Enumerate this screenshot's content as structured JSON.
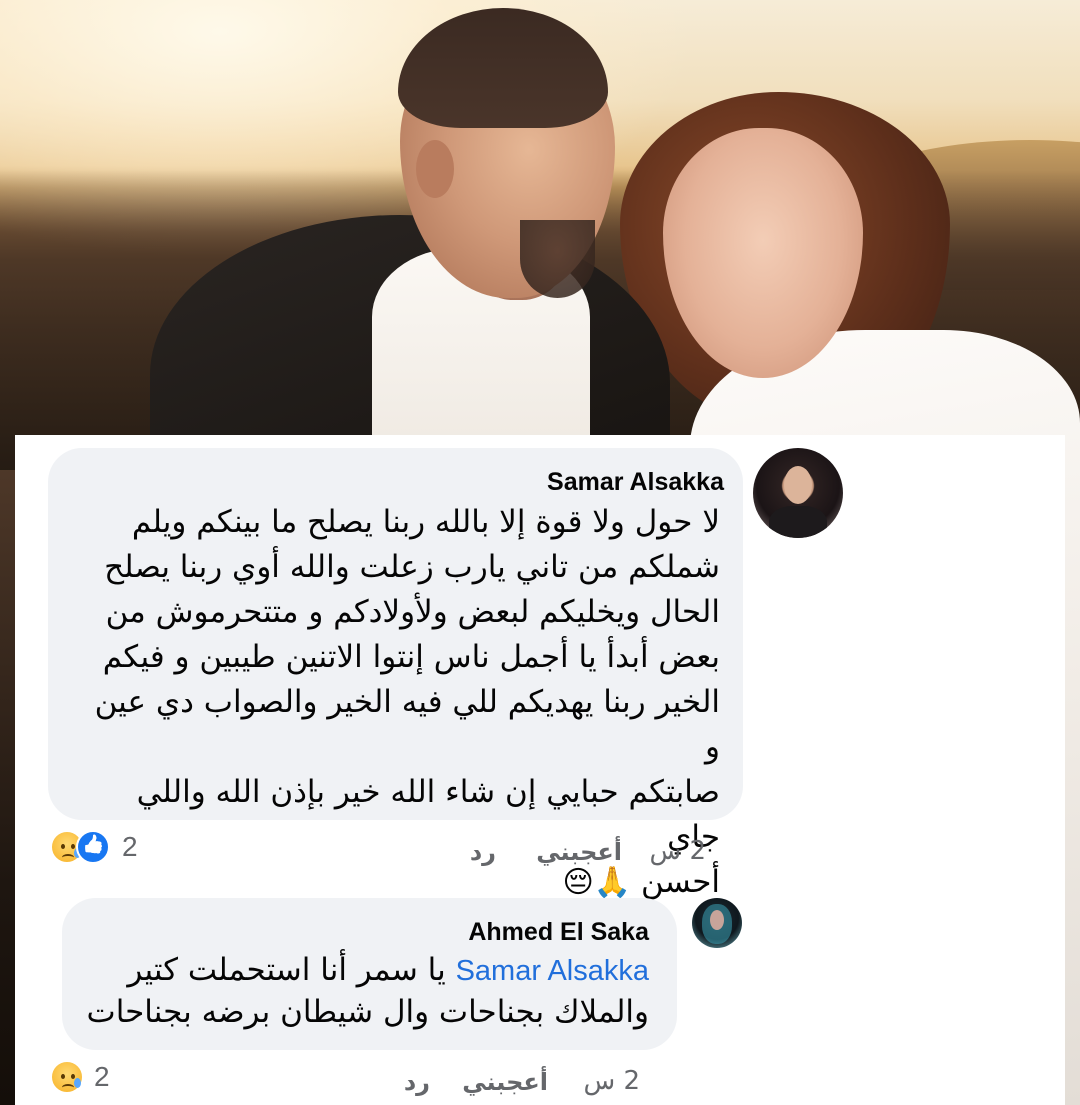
{
  "comments": [
    {
      "author": "Samar Alsakka",
      "lines": [
        "لا حول ولا قوة إلا بالله ربنا يصلح ما بينكم ويلم",
        "شملكم من تاني يارب زعلت والله أوي ربنا يصلح",
        "الحال ويخليكم لبعض ولأولادكم و متتحرموش من",
        "بعض أبدأ يا أجمل ناس إنتوا الاتنين طيبين و فيكم",
        "الخير ربنا يهديكم للي فيه الخير والصواب دي عين و",
        "صابتكم حبايي إن شاء الله خير بإذن الله واللي جاي",
        "أحسن"
      ],
      "emojis": "🙏😔",
      "time": "2 س",
      "like_label": "أعجبني",
      "reply_label": "رد",
      "reaction_count": "2",
      "reactions": [
        "like",
        "sad"
      ]
    },
    {
      "author": "Ahmed El Saka",
      "mention": "Samar Alsakka",
      "line1_rest": "يا سمر أنا استحملت كتير",
      "line2": "والملاك بجناحات وال شيطان برضه بجناحات",
      "time": "2 س",
      "like_label": "أعجبني",
      "reply_label": "رد",
      "reaction_count": "2",
      "reactions": [
        "sad"
      ]
    }
  ],
  "colors": {
    "bubble": "#f0f2f5",
    "mention": "#216fdb",
    "meta": "#65676b",
    "like": "#1877f2"
  }
}
